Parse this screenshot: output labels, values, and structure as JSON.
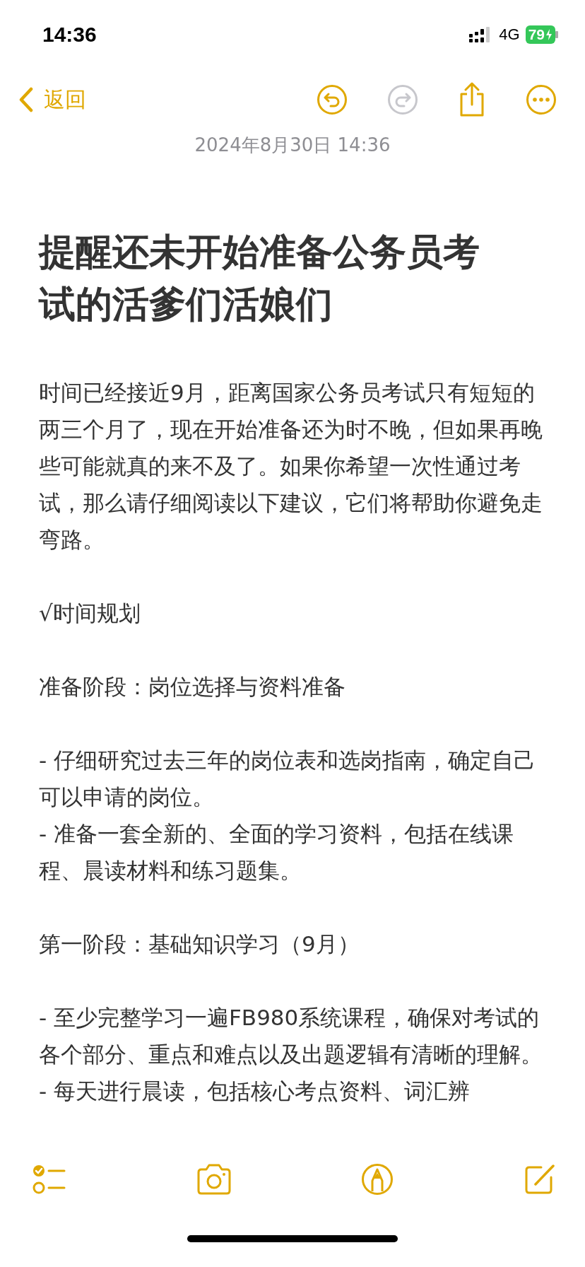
{
  "status_bar": {
    "time": "14:36",
    "network": "4G",
    "battery": "79"
  },
  "nav": {
    "back_label": "返回",
    "undo_disabled": false,
    "redo_disabled": true
  },
  "date": "2024年8月30日 14:36",
  "note": {
    "title": "提醒还未开始准备公务员考试的活爹们活娘们",
    "blocks": [
      [
        "时间已经接近9月，距离国家公务员考试只有短短的两三个月了，现在开始准备还为时不晚，但如果再晚些可能就真的来不及了。如果你希望一次性通过考试，那么请仔细阅读以下建议，它们将帮助你避免走弯路。"
      ],
      [
        "√时间规划"
      ],
      [
        "准备阶段：岗位选择与资料准备"
      ],
      [
        "- 仔细研究过去三年的岗位表和选岗指南，确定自己可以申请的岗位。",
        "- 准备一套全新的、全面的学习资料，包括在线课程、晨读材料和练习题集。"
      ],
      [
        "第一阶段：基础知识学习（9月）"
      ],
      [
        "- 至少完整学习一遍FB980系统课程，确保对考试的各个部分、重点和难点以及出题逻辑有清晰的理解。",
        "- 每天进行晨读，包括核心考点资料、词汇辨"
      ]
    ]
  }
}
